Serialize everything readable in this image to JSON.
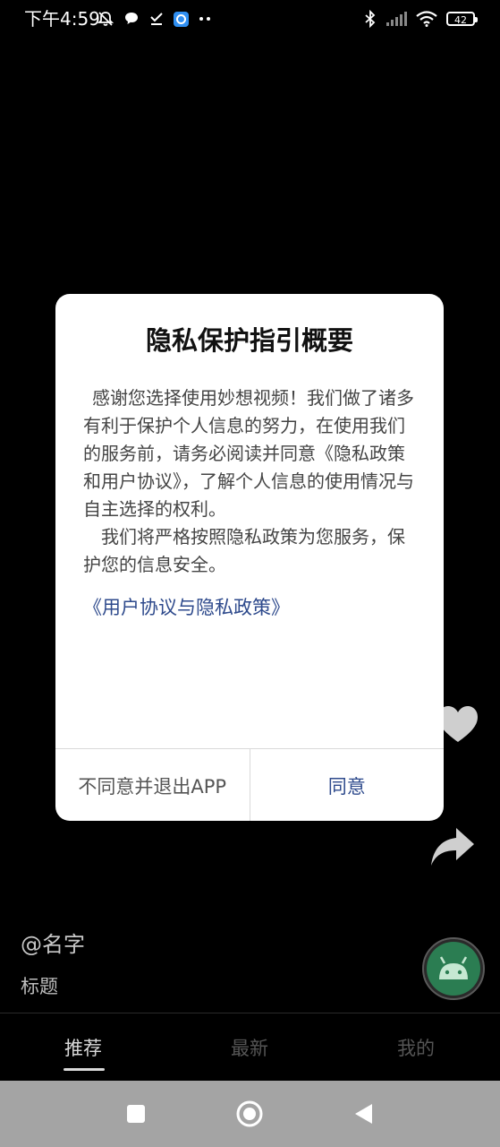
{
  "status_bar": {
    "time": "下午4:59",
    "battery": "42",
    "left_icons": [
      "mute-icon",
      "chat-bubble-icon",
      "download-check-icon",
      "app-badge-icon",
      "more-dots-icon"
    ],
    "right_icons": [
      "bluetooth-icon",
      "signal-icon",
      "wifi-icon",
      "battery-icon"
    ]
  },
  "feed": {
    "author": "@名字",
    "title": "标题"
  },
  "dialog": {
    "title": "隐私保护指引概要",
    "paragraph1": "感谢您选择使用妙想视频！我们做了诸多有利于保护个人信息的努力，在使用我们的服务前，请务必阅读并同意《隐私政策和用户协议》，了解个人信息的使用情况与自主选择的权利。",
    "paragraph2": "我们将严格按照隐私政策为您服务，保护您的信息安全。",
    "link": "《用户协议与隐私政策》",
    "decline_label": "不同意并退出APP",
    "agree_label": "同意"
  },
  "bottom_nav": {
    "tabs": [
      {
        "label": "推荐",
        "active": true
      },
      {
        "label": "最新",
        "active": false
      },
      {
        "label": "我的",
        "active": false
      }
    ]
  },
  "colors": {
    "accent": "#2e4a8c",
    "background": "#000000",
    "system_nav": "#a4a4a4"
  }
}
